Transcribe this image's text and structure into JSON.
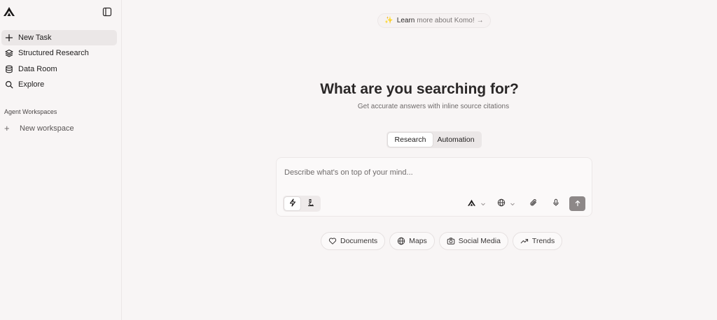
{
  "sidebar": {
    "logo_icon": "komo-logo",
    "toggle_icon": "sidebar-toggle-icon",
    "nav": [
      {
        "label": "New Task",
        "icon": "plus-icon",
        "active": true
      },
      {
        "label": "Structured Research",
        "icon": "layers-icon",
        "active": false
      },
      {
        "label": "Data Room",
        "icon": "database-icon",
        "active": false
      },
      {
        "label": "Explore",
        "icon": "search-icon",
        "active": false
      }
    ],
    "section_label": "Agent Workspaces",
    "new_workspace_label": "New workspace"
  },
  "main": {
    "learn_more": {
      "prefix": "Learn",
      "rest": "more about Komo!",
      "arrow": "→",
      "icon": "sparkle-icon"
    },
    "headline": "What are you searching for?",
    "subline": "Get accurate answers with inline source citations",
    "mode_tabs": [
      {
        "label": "Research",
        "selected": true
      },
      {
        "label": "Automation",
        "selected": false
      }
    ],
    "composer": {
      "placeholder": "Describe what's on top of your mind...",
      "value": "",
      "tools": [
        {
          "icon": "lightning-icon",
          "active": true
        },
        {
          "icon": "microscope-icon",
          "active": false
        }
      ],
      "right_controls": [
        "komo-model-icon",
        "globe-icon",
        "paperclip-icon",
        "mic-icon",
        "send-arrow-icon"
      ]
    },
    "chips": [
      {
        "label": "Documents",
        "icon": "heart-icon"
      },
      {
        "label": "Maps",
        "icon": "globe-icon"
      },
      {
        "label": "Social Media",
        "icon": "camera-icon"
      },
      {
        "label": "Trends",
        "icon": "trend-icon"
      }
    ]
  },
  "colors": {
    "background": "#f8f5f5",
    "accent_spark": "#e2a93a",
    "send_button": "#8d8888"
  }
}
